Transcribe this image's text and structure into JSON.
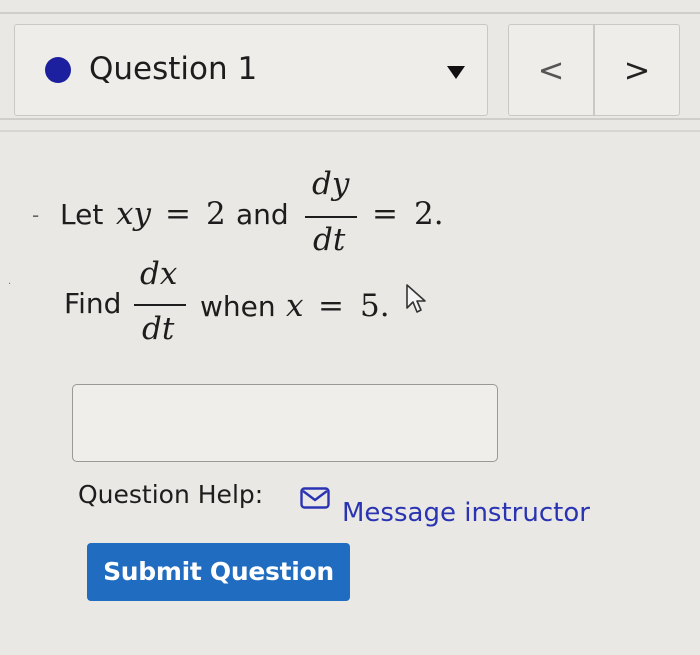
{
  "header": {
    "question_label": "Question 1",
    "status_color": "#1c1f9e",
    "prev_label": "<",
    "next_label": ">"
  },
  "problem": {
    "line1": {
      "let": "Let",
      "var_xy": "xy",
      "equals": "=",
      "value": "2",
      "and": "and",
      "frac_num": "dy",
      "frac_den": "dt",
      "equals2": "=",
      "value2": "2."
    },
    "line2": {
      "find": "Find",
      "frac_num": "dx",
      "frac_den": "dt",
      "when": "when",
      "var_x": "x",
      "equals": "=",
      "value": "5."
    }
  },
  "answer": {
    "value": ""
  },
  "help": {
    "label": "Question Help:",
    "link_label": "Message instructor",
    "link_icon": "mail-icon"
  },
  "actions": {
    "submit_label": "Submit Question"
  }
}
